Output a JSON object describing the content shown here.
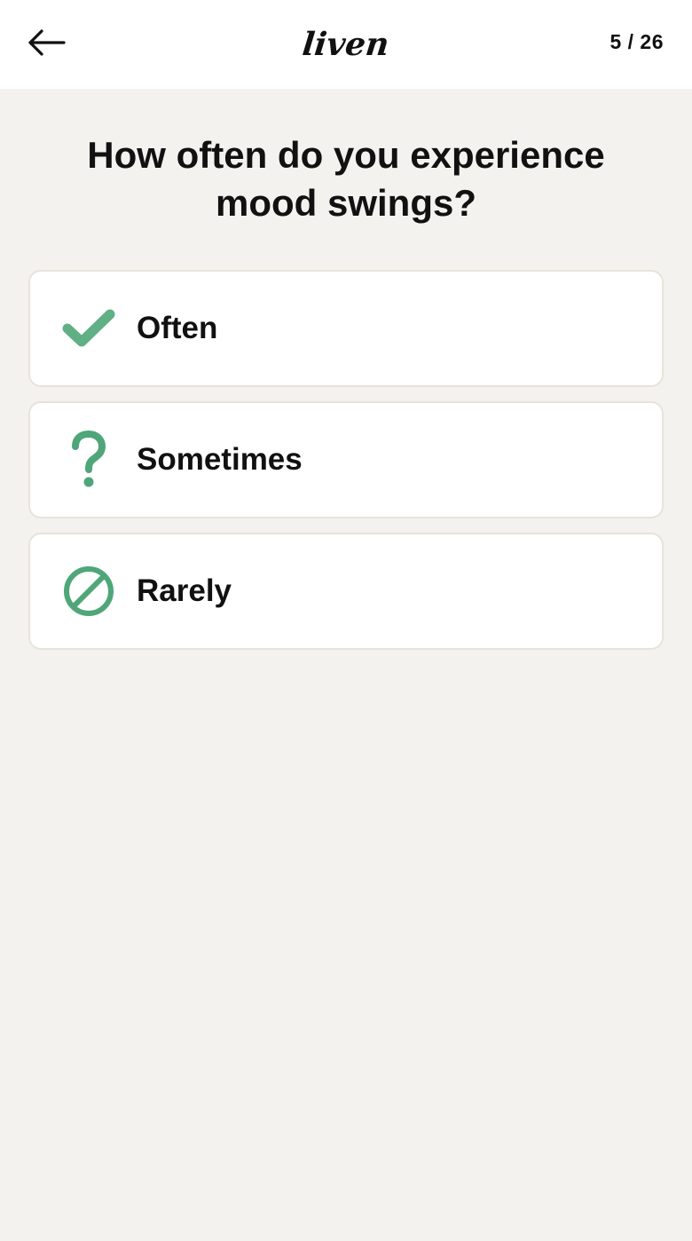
{
  "header": {
    "back_icon": "arrow-left-icon",
    "logo_text": "liven",
    "progress": "5 / 26"
  },
  "question": "How often do you experience mood swings?",
  "options": [
    {
      "label": "Often",
      "icon": "checkmark-icon"
    },
    {
      "label": "Sometimes",
      "icon": "question-mark-icon"
    },
    {
      "label": "Rarely",
      "icon": "prohibited-icon"
    }
  ],
  "colors": {
    "background": "#f4f2ef",
    "header_background": "#ffffff",
    "card_background": "#ffffff",
    "card_border": "#e8e3da",
    "icon_green": "#4fa678",
    "text": "#111111"
  }
}
